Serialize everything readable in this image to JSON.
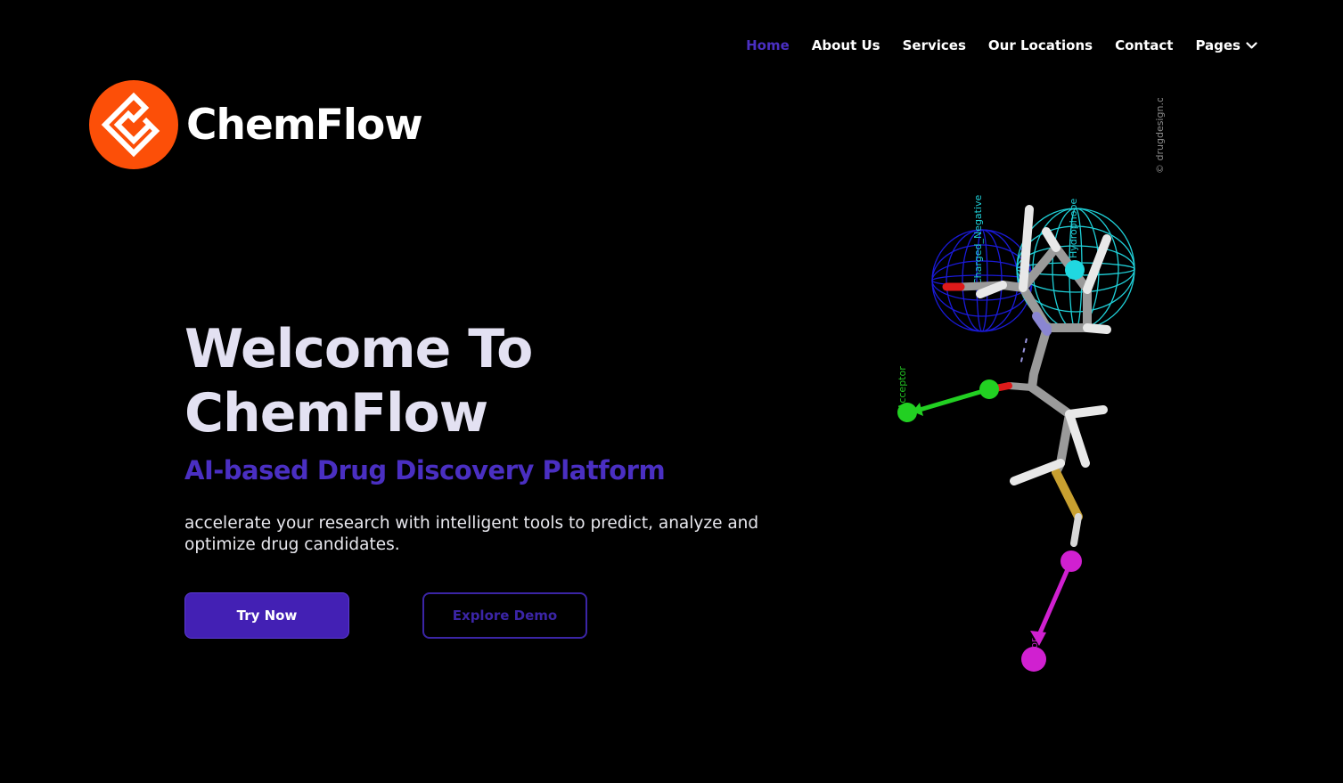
{
  "nav": {
    "items": [
      {
        "label": "Home",
        "active": true
      },
      {
        "label": "About Us",
        "active": false
      },
      {
        "label": "Services",
        "active": false
      },
      {
        "label": "Our Locations",
        "active": false
      },
      {
        "label": "Contact",
        "active": false
      }
    ],
    "pages_label": "Pages"
  },
  "brand": {
    "name": "ChemFlow",
    "logo_color": "#fc4f08"
  },
  "hero": {
    "title_line1": "Welcome To",
    "title_line2": "ChemFlow",
    "subtitle": "AI-based Drug Discovery Platform",
    "description": "accelerate your research with intelligent tools to predict, analyze and optimize drug candidates.",
    "primary_button": "Try Now",
    "secondary_button": "Explore Demo"
  },
  "molecule": {
    "watermark": "© drugdesign.org",
    "labels": {
      "negative": "Charged_Negative",
      "hydrophobe": "Hydrophobe",
      "acceptor": "Acceptor",
      "donor": "Donor"
    }
  },
  "colors": {
    "accent": "#4a2fc2",
    "background": "#000000",
    "title": "#e3e1f2"
  }
}
